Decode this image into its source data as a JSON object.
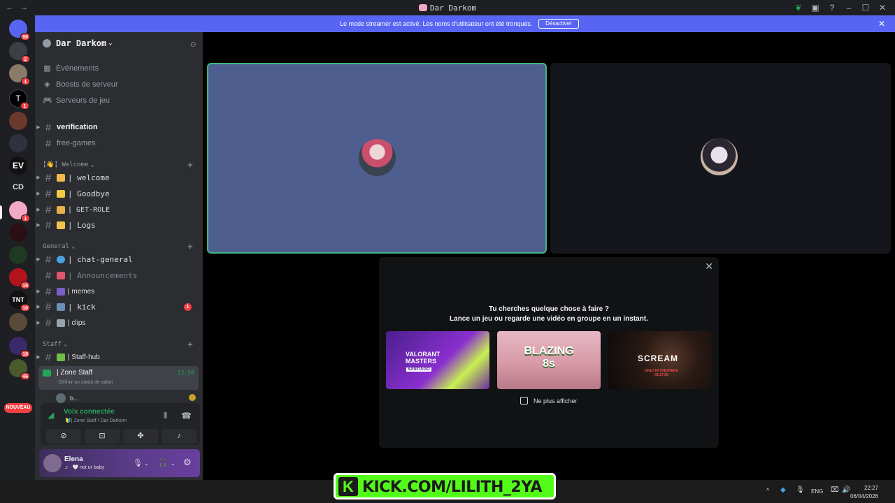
{
  "window": {
    "title": "Dar Darkom"
  },
  "banner": {
    "text": "Le mode streamer est activé. Les noms d'utilisateur ont été tronqués.",
    "button": "Désactiver"
  },
  "guilds": [
    {
      "badge": "98"
    },
    {
      "badge": "2"
    },
    {
      "badge": "1"
    },
    {
      "badge": "1"
    },
    {
      "badge": ""
    },
    {
      "badge": ""
    },
    {
      "badge": ""
    },
    {
      "label": "CD"
    },
    {
      "badge": "1"
    },
    {
      "badge": ""
    },
    {
      "badge": ""
    },
    {
      "badge": "15"
    },
    {
      "badge": "10"
    },
    {
      "badge": ""
    },
    {
      "badge": "18"
    },
    {
      "badge": "46"
    }
  ],
  "new_label": "NOUVEAU",
  "server": {
    "name": "Dar Darkom"
  },
  "menu": [
    {
      "label": "Événements"
    },
    {
      "label": "Boosts de serveur"
    },
    {
      "label": "Serveurs de jeu"
    }
  ],
  "channels_top": [
    {
      "name": "verification"
    },
    {
      "name": "free-games"
    }
  ],
  "categories": {
    "welcome": "╏👋╏ Welcome",
    "general": "General",
    "staff": "Staff"
  },
  "welcome_channels": [
    {
      "name": "| welcome"
    },
    {
      "name": "| Goodbye"
    },
    {
      "name": "| GET-ROLE"
    },
    {
      "name": "| Logs"
    }
  ],
  "general_channels": [
    {
      "name": "| chat-general"
    },
    {
      "name": "| Announcements"
    },
    {
      "name": "| memes"
    },
    {
      "name": "| kick",
      "badge": "1"
    },
    {
      "name": "| clips"
    }
  ],
  "staff_channels": [
    {
      "name": "| Staff-hub"
    }
  ],
  "voice_channel": {
    "name": "| Zone Staff",
    "time": "12:50",
    "status": "Définir un statut de salon"
  },
  "voice_user": {
    "name": "b..."
  },
  "voice_panel": {
    "title": "Voix connectée",
    "subtitle": "🔰| Zone Staff / Dar Darkom"
  },
  "user": {
    "name": "Elena",
    "status": "♫ · 🤍 not ur baby"
  },
  "activity": {
    "line1": "Tu cherches quelque chose à faire ?",
    "line2": "Lance un jeu ou regarde une vidéo en groupe en un instant.",
    "cards": [
      {
        "title": "VALORANT MASTERS",
        "sub": "SANTIAGO"
      },
      {
        "title": "BLAZING 8s",
        "sub": ""
      },
      {
        "title": "SCREAM",
        "sub": "ONLY IN THEATERS 02.27.26"
      }
    ],
    "checkbox": "Ne plus afficher"
  },
  "overlay": {
    "kick_text": "KICK.COM/LILITH_2YA"
  },
  "taskbar": {
    "lang": "ENG",
    "time": "22:27",
    "date": "06/04/2026"
  }
}
